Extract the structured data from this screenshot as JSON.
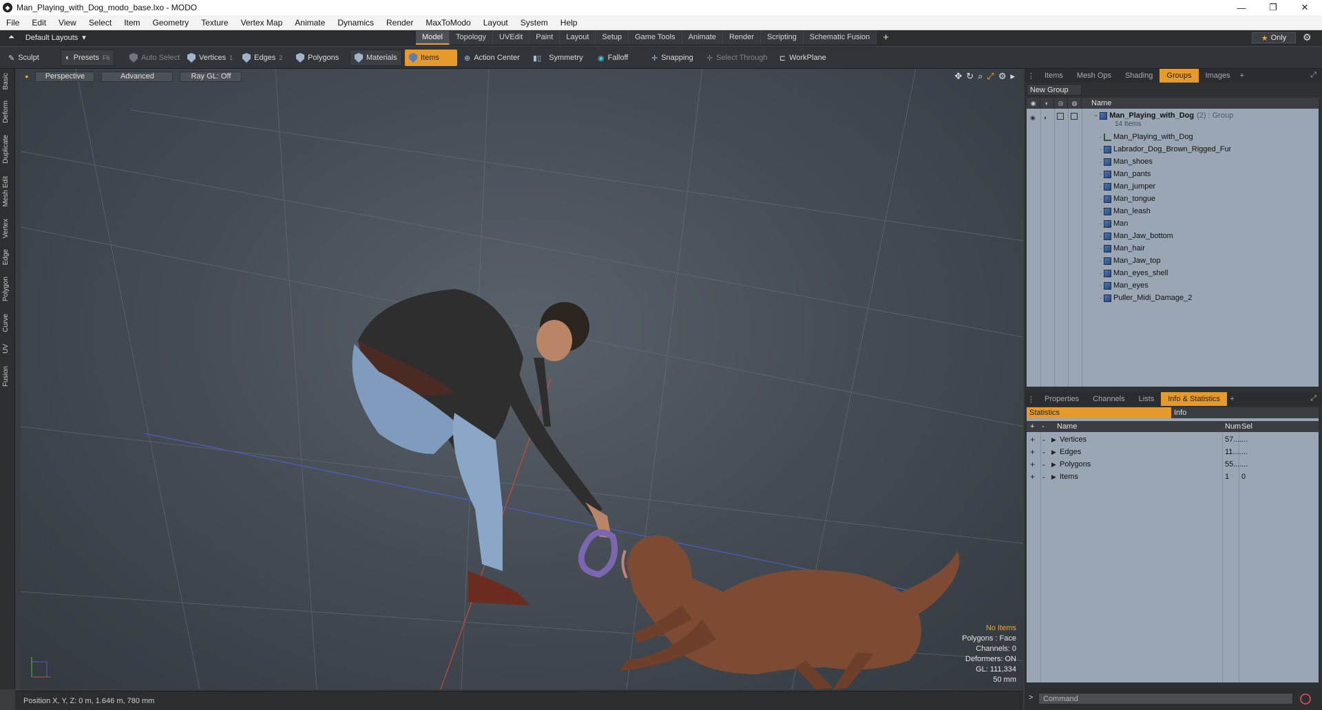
{
  "window": {
    "title": "Man_Playing_with_Dog_modo_base.lxo - MODO"
  },
  "menu": [
    "File",
    "Edit",
    "View",
    "Select",
    "Item",
    "Geometry",
    "Texture",
    "Vertex Map",
    "Animate",
    "Dynamics",
    "Render",
    "MaxToModo",
    "Layout",
    "System",
    "Help"
  ],
  "layout": {
    "name": "Default Layouts",
    "tabs": [
      "Model",
      "Topology",
      "UVEdit",
      "Paint",
      "Layout",
      "Setup",
      "Game Tools",
      "Animate",
      "Render",
      "Scripting",
      "Schematic Fusion"
    ],
    "active_tab": "Model",
    "only_label": "Only"
  },
  "toolbar": {
    "sculpt": "Sculpt",
    "presets": "Presets",
    "presets_key": "F6",
    "auto_select": "Auto Select",
    "vertices": "Vertices",
    "vertices_key": "1",
    "edges": "Edges",
    "edges_key": "2",
    "polygons": "Polygons",
    "materials": "Materials",
    "items": "Items",
    "action_center": "Action Center",
    "symmetry": "Symmetry",
    "falloff": "Falloff",
    "snapping": "Snapping",
    "select_through": "Select Through",
    "workplane": "WorkPlane"
  },
  "left_tabs": [
    "Basic",
    "Deform",
    "Duplicate",
    "Mesh Edit",
    "Vertex",
    "Edge",
    "Polygon",
    "Curve",
    "UV",
    "Fusion"
  ],
  "viewport": {
    "projection": "Perspective",
    "shading": "Advanced",
    "raygl": "Ray GL: Off",
    "info": {
      "selection": "No Items",
      "polygons": "Polygons : Face",
      "channels": "Channels: 0",
      "deformers": "Deformers: ON",
      "gl": "GL: 111,334",
      "scale": "50 mm"
    }
  },
  "status": {
    "position": "Position X, Y, Z:  0 m, 1.646 m, 780 mm"
  },
  "top_panel": {
    "tabs": [
      "Items",
      "Mesh Ops",
      "Shading",
      "Groups",
      "Images"
    ],
    "active_tab": "Groups",
    "new_group": "New Group",
    "column_name": "Name",
    "group": {
      "name": "Man_Playing_with_Dog",
      "suffix": "(2) : Group",
      "count": "14 Items"
    },
    "items": [
      "Man_Playing_with_Dog",
      "Labrador_Dog_Brown_Rigged_Fur",
      "Man_shoes",
      "Man_pants",
      "Man_jumper",
      "Man_tongue",
      "Man_leash",
      "Man",
      "Man_Jaw_bottom",
      "Man_hair",
      "Man_Jaw_top",
      "Man_eyes_shell",
      "Man_eyes",
      "Puller_Midi_Damage_2"
    ]
  },
  "bottom_panel": {
    "tabs": [
      "Properties",
      "Channels",
      "Lists",
      "Info & Statistics"
    ],
    "active_tab": "Info & Statistics",
    "subtabs": [
      "Statistics",
      "Info"
    ],
    "columns": [
      "Name",
      "Num",
      "Sel"
    ],
    "rows": [
      {
        "name": "Vertices",
        "num": "57....",
        "sel": "..."
      },
      {
        "name": "Edges",
        "num": "11....",
        "sel": "..."
      },
      {
        "name": "Polygons",
        "num": "55....",
        "sel": "..."
      },
      {
        "name": "Items",
        "num": "1",
        "sel": "0"
      }
    ]
  },
  "command": {
    "placeholder": "Command",
    "prompt": ">"
  },
  "colors": {
    "accent": "#e79a2c",
    "panel_list": "#9aa6b4",
    "viewport": "#464d55"
  }
}
